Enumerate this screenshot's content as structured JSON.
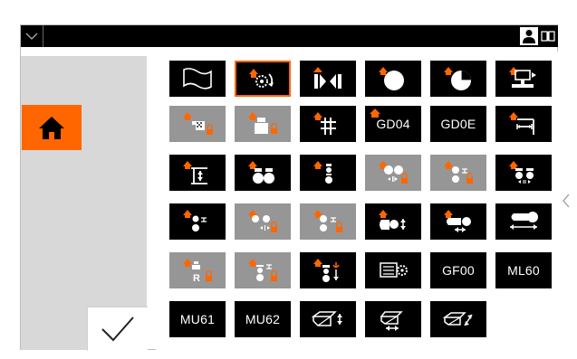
{
  "topbar": {
    "menu_icon": "chevron-down-icon",
    "user_icon": "user-icon",
    "book_icon": "book-icon"
  },
  "sidebar": {
    "home_icon": "home-icon",
    "confirm_icon": "checkmark-icon"
  },
  "colors": {
    "accent": "#ff6600",
    "tile": "#000000",
    "tile_disabled": "#969696",
    "panel": "#d8d8d8"
  },
  "grid": {
    "row1": [
      "flag",
      "rotate-tool",
      "jaw-close",
      "disc",
      "pie-quarter",
      "machine-drive"
    ],
    "row2": [
      "pattern-disabled",
      "gauge-disabled",
      "grid-hash",
      "GD04",
      "GD0E",
      "width-measure"
    ],
    "row3_labels": [],
    "text_tiles": {
      "t1": "GD04",
      "t2": "GD0E",
      "t3": "GF00",
      "t4": "ML60",
      "t5": "MU61",
      "t6": "MU62"
    }
  },
  "right_panel_arrow": "chevron-left-icon"
}
